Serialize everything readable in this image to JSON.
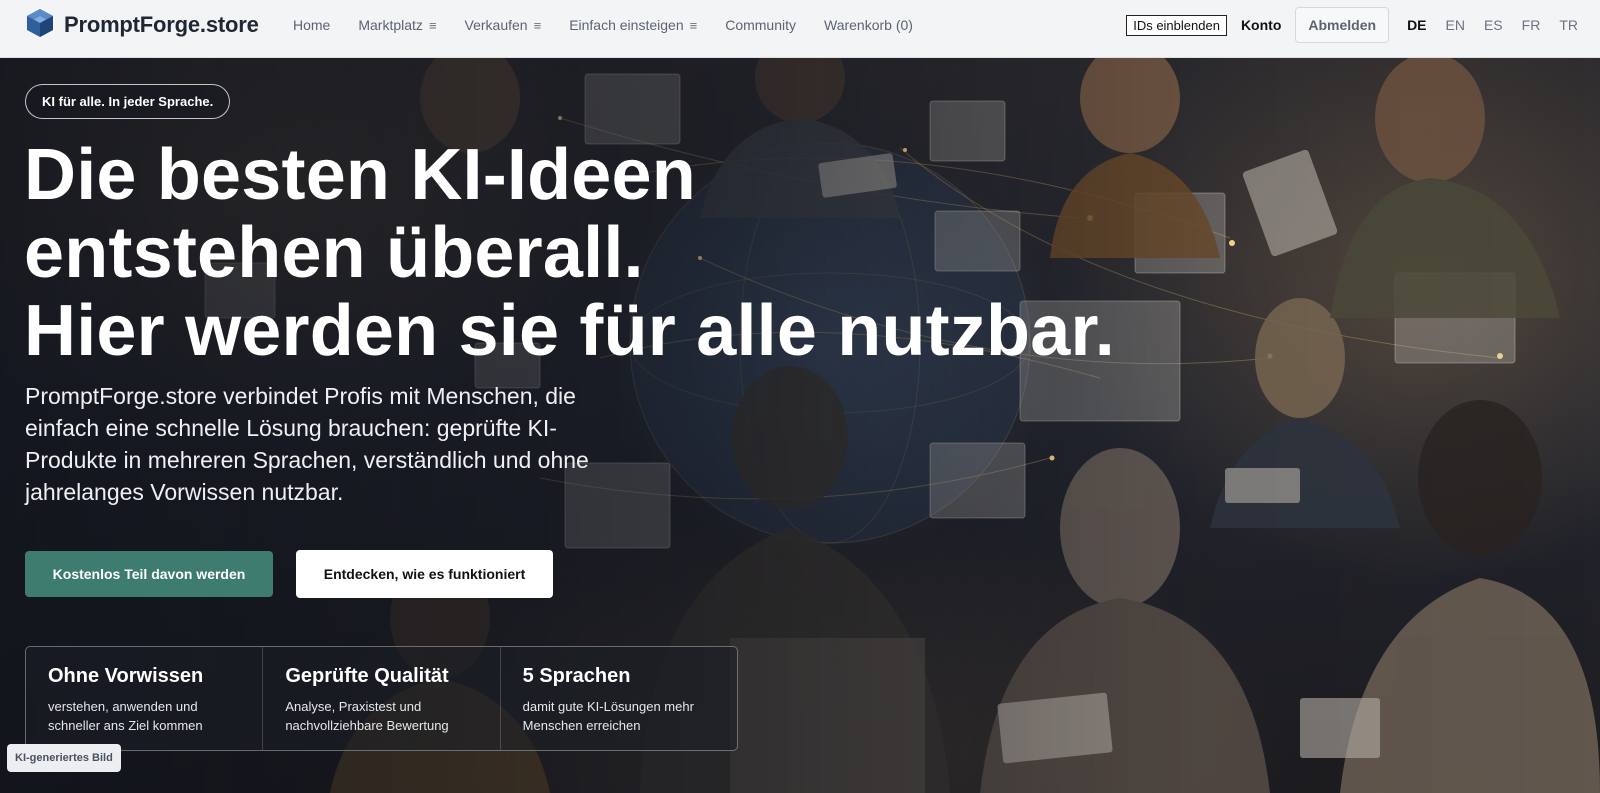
{
  "brand": {
    "name": "PromptForge.store",
    "logo_icon": "cube-logo-icon",
    "logo_color": "#2f5f9e"
  },
  "nav": {
    "items": [
      {
        "label": "Home",
        "has_menu": false
      },
      {
        "label": "Marktplatz",
        "has_menu": true
      },
      {
        "label": "Verkaufen",
        "has_menu": true
      },
      {
        "label": "Einfach einsteigen",
        "has_menu": true
      },
      {
        "label": "Community",
        "has_menu": false
      },
      {
        "label": "Warenkorb (0)",
        "has_menu": false
      }
    ],
    "menu_glyph": "≡"
  },
  "tools": {
    "ids_label": "IDs einblenden",
    "account_label": "Konto",
    "logout_label": "Abmelden",
    "languages": [
      "DE",
      "EN",
      "ES",
      "FR",
      "TR"
    ],
    "active_language": "DE"
  },
  "hero": {
    "tagline": "KI für alle. In jeder Sprache.",
    "headline": [
      "Die besten KI-Ideen",
      "entstehen überall.",
      "Hier werden sie für alle nutzbar."
    ],
    "subline": "PromptForge.store verbindet Profis mit Menschen, die einfach eine schnelle Lösung brauchen: geprüfte KI-Produkte in mehreren Sprachen, verständlich und ohne jahrelanges Vorwissen nutzbar.",
    "cta_primary": "Kostenlos Teil davon werden",
    "cta_secondary": "Entdecken, wie es funktioniert",
    "accent_color": "#3d7c6e",
    "features": [
      {
        "title": "Ohne Vorwissen",
        "text": "verstehen, anwenden und schneller ans Ziel kommen"
      },
      {
        "title": "Geprüfte Qualität",
        "text": "Analyse, Praxistest und nachvollziehbare Bewertung"
      },
      {
        "title": "5 Sprachen",
        "text": "damit gute KI-Lösungen mehr Menschen erreichen"
      }
    ],
    "image_badge": "KI-generiertes Bild"
  }
}
